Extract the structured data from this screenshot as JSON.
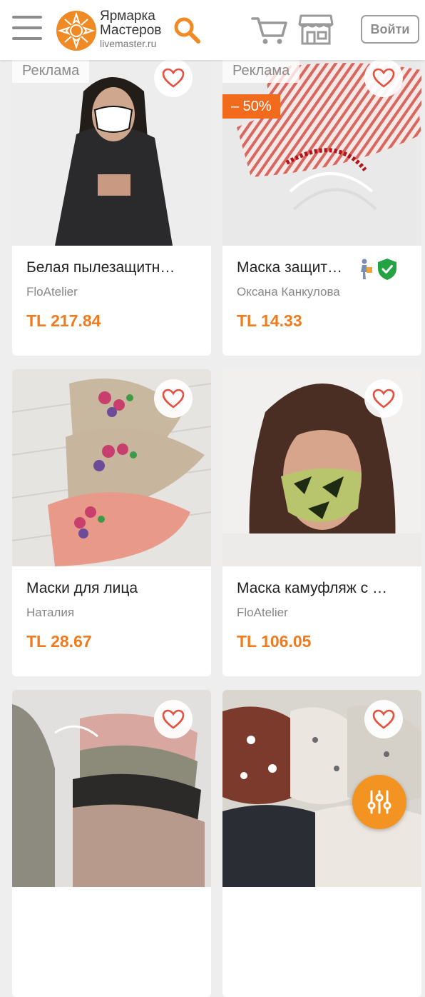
{
  "header": {
    "logo_line1": "Ярмарка",
    "logo_line2": "Мастеров",
    "logo_url": "livemaster.ru",
    "login_label": "Войти"
  },
  "colors": {
    "accent": "#f07b1e",
    "discount": "#f26b1d",
    "fab": "#f39321"
  },
  "icons": {
    "menu": "hamburger-icon",
    "search": "search-icon",
    "cart": "cart-icon",
    "shop": "shop-icon",
    "favorite": "heart-icon",
    "filter": "filter-icon",
    "delivery": "delivery-icon",
    "verified": "shield-check-icon"
  },
  "products": [
    {
      "ad_label": "Реклама",
      "title": "Белая пылезащитн…",
      "seller": "FloAtelier",
      "price": "TL 217.84"
    },
    {
      "ad_label": "Реклама",
      "discount": "– 50%",
      "title": "Маска защит…",
      "seller": "Оксана Канкулова",
      "price": "TL 14.33"
    },
    {
      "title": "Маски для лица",
      "seller": "Наталия",
      "price": "TL 28.67"
    },
    {
      "title": "Маска камуфляж с …",
      "seller": "FloAtelier",
      "price": "TL 106.05"
    },
    {
      "title": "",
      "seller": "",
      "price": ""
    },
    {
      "title": "",
      "seller": "",
      "price": ""
    }
  ]
}
